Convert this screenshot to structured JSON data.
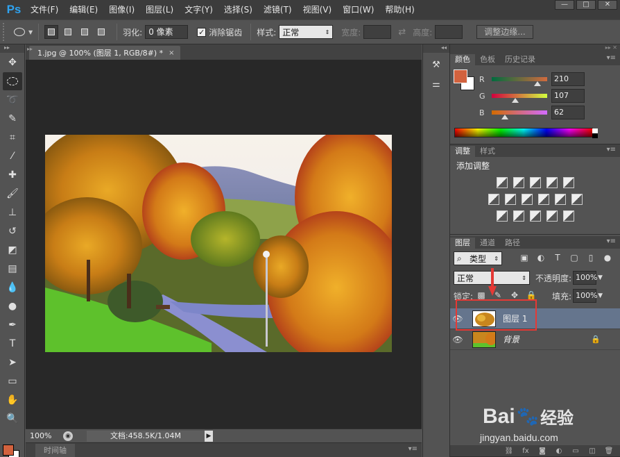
{
  "app": {
    "logo": "Ps",
    "menu": [
      "文件(F)",
      "编辑(E)",
      "图像(I)",
      "图层(L)",
      "文字(Y)",
      "选择(S)",
      "滤镜(T)",
      "视图(V)",
      "窗口(W)",
      "帮助(H)"
    ],
    "window_controls": [
      "—",
      "□",
      "✕"
    ]
  },
  "options": {
    "feather_label": "羽化:",
    "feather_value": "0 像素",
    "antialias_label": "消除锯齿",
    "antialias_checked": "✓",
    "style_label": "样式:",
    "style_value": "正常",
    "width_label": "宽度:",
    "height_label": "高度:",
    "refine_edge": "调整边缘..."
  },
  "document": {
    "tab_title": "1.jpg @ 100% (图层 1, RGB/8#) *",
    "tab_close": "×",
    "zoom": "100%",
    "doc_info": "文档:458.5K/1.04M"
  },
  "timeline": {
    "label": "时间轴"
  },
  "color_panel": {
    "tabs": [
      "颜色",
      "色板",
      "历史记录"
    ],
    "channels": [
      {
        "label": "R",
        "value": "210",
        "fraction": 0.824
      },
      {
        "label": "G",
        "value": "107",
        "fraction": 0.42
      },
      {
        "label": "B",
        "value": "62",
        "fraction": 0.243
      }
    ],
    "fg_color": "#d2623e"
  },
  "adjust_panel": {
    "tabs": [
      "调整",
      "样式"
    ],
    "title": "添加调整"
  },
  "layers_panel": {
    "tabs": [
      "图层",
      "通道",
      "路径"
    ],
    "filter_type": "类型",
    "blend_mode": "正常",
    "opacity_label": "不透明度:",
    "opacity_value": "100%",
    "lock_label": "锁定:",
    "fill_label": "填充:",
    "fill_value": "100%",
    "layers": [
      {
        "name": "图层 1",
        "selected": true
      },
      {
        "name": "背景",
        "selected": false,
        "locked": true
      }
    ]
  },
  "watermark": {
    "brand": "Bai",
    "brand2": "经验",
    "url": "jingyan.baidu.com"
  }
}
